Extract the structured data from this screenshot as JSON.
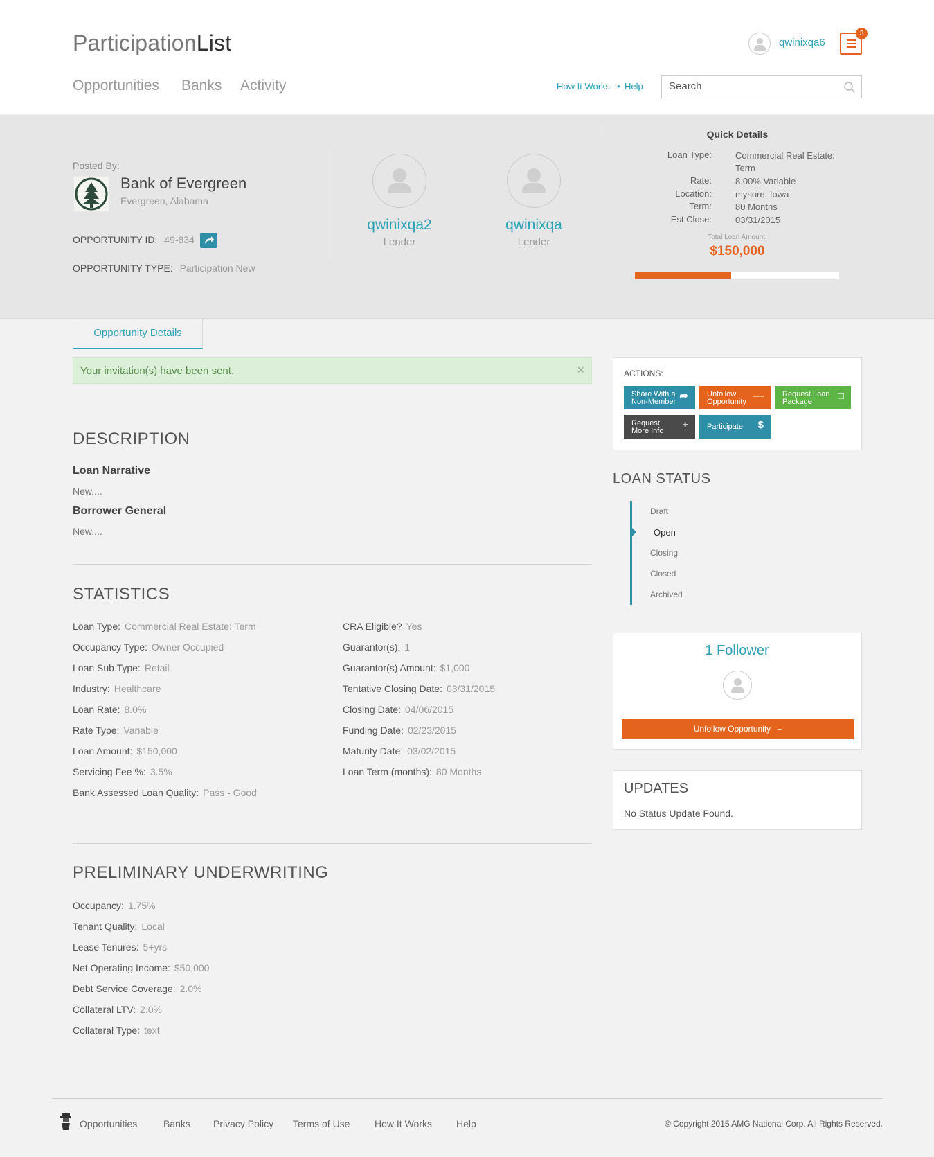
{
  "header": {
    "logo_light": "Participation",
    "logo_bold": "List",
    "nav": [
      "Opportunities",
      "Banks",
      "Activity"
    ],
    "user_name": "qwinixqa6",
    "notification_count": "3",
    "links": [
      "How It Works",
      "•",
      "Help"
    ],
    "search_placeholder": "Search"
  },
  "posting": {
    "posted_by_label": "Posted By:",
    "bank_name": "Bank of Evergreen",
    "bank_location": "Evergreen, Alabama",
    "opportunity_id_label": "OPPORTUNITY ID:",
    "opportunity_id": "49-834",
    "opportunity_type_label": "OPPORTUNITY TYPE:",
    "opportunity_type": "Participation New"
  },
  "lenders": [
    {
      "name": "qwinixqa2",
      "role": "Lender"
    },
    {
      "name": "qwinixqa",
      "role": "Lender"
    }
  ],
  "quick_details": {
    "title": "Quick Details",
    "rows": [
      {
        "key": "Loan Type:",
        "value": "Commercial Real Estate: Term"
      },
      {
        "key": "Rate:",
        "value": "8.00% Variable"
      },
      {
        "key": "Location:",
        "value": "mysore, Iowa"
      },
      {
        "key": "Term:",
        "value": "80 Months"
      },
      {
        "key": "Est Close:",
        "value": "03/31/2015"
      }
    ],
    "total_label": "Total Loan Amount:",
    "total_amount": "$150,000",
    "funded_fraction": 0.47,
    "accent_color": "#e5641d"
  },
  "tab": {
    "label": "Opportunity Details"
  },
  "alert": {
    "message": "Your invitation(s) have been sent.",
    "close": "×"
  },
  "description": {
    "title": "DESCRIPTION",
    "sections": [
      {
        "heading": "Loan Narrative",
        "text": "New...."
      },
      {
        "heading": "Borrower General",
        "text": "New...."
      }
    ]
  },
  "statistics": {
    "title": "STATISTICS",
    "left": [
      {
        "key": "Loan Type:",
        "value": "Commercial Real Estate: Term"
      },
      {
        "key": "Occupancy Type:",
        "value": "Owner Occupied"
      },
      {
        "key": "Loan Sub Type:",
        "value": "Retail"
      },
      {
        "key": "Industry:",
        "value": "Healthcare"
      },
      {
        "key": "Loan Rate:",
        "value": "8.0%"
      },
      {
        "key": "Rate Type:",
        "value": "Variable"
      },
      {
        "key": "Loan Amount:",
        "value": "$150,000"
      },
      {
        "key": "Servicing Fee %:",
        "value": "3.5%"
      },
      {
        "key": "Bank Assessed Loan Quality:",
        "value": "Pass - Good"
      }
    ],
    "right": [
      {
        "key": "CRA Eligible?",
        "value": "Yes"
      },
      {
        "key": "Guarantor(s):",
        "value": "1"
      },
      {
        "key": "Guarantor(s) Amount:",
        "value": "$1,000"
      },
      {
        "key": "Tentative Closing Date:",
        "value": "03/31/2015"
      },
      {
        "key": "Closing Date:",
        "value": "04/06/2015"
      },
      {
        "key": "Funding Date:",
        "value": "02/23/2015"
      },
      {
        "key": "Maturity Date:",
        "value": "03/02/2015"
      },
      {
        "key": "Loan Term (months):",
        "value": "80 Months"
      }
    ]
  },
  "underwriting": {
    "title": "PRELIMINARY UNDERWRITING",
    "rows": [
      {
        "key": "Occupancy:",
        "value": "1.75%"
      },
      {
        "key": "Tenant Quality:",
        "value": "Local"
      },
      {
        "key": "Lease Tenures:",
        "value": "5+yrs"
      },
      {
        "key": "Net Operating Income:",
        "value": "$50,000"
      },
      {
        "key": "Debt Service Coverage:",
        "value": "2.0%"
      },
      {
        "key": "Collateral LTV:",
        "value": "2.0%"
      },
      {
        "key": "Collateral Type:",
        "value": "text"
      }
    ]
  },
  "actions": {
    "title": "ACTIONS:",
    "buttons": [
      {
        "line1": "Share With a",
        "line2": "Non-Member",
        "icon": "share-icon",
        "color": "#2f8ea8"
      },
      {
        "line1": "Unfollow",
        "line2": "Opportunity",
        "icon": "minus-icon",
        "color": "#e5641d"
      },
      {
        "line1": "Request Loan",
        "line2": "Package",
        "icon": "document-icon",
        "color": "#5cb545"
      },
      {
        "line1": "Request",
        "line2": "More Info",
        "icon": "plus-icon",
        "color": "#4a4a4a"
      },
      {
        "line1": "Participate",
        "line2": "",
        "icon": "dollar-icon",
        "color": "#2f8ea8"
      }
    ]
  },
  "loan_status": {
    "title": "LOAN STATUS",
    "items": [
      "Draft",
      "Open",
      "Closing",
      "Closed",
      "Archived"
    ],
    "current": "Open"
  },
  "followers": {
    "title": "1 Follower",
    "button": "Unfollow Opportunity"
  },
  "updates": {
    "title": "UPDATES",
    "text": "No Status Update Found."
  },
  "footer": {
    "nav": [
      "Opportunities",
      "Banks",
      "Privacy Policy",
      "Terms of Use",
      "How It Works",
      "Help"
    ],
    "copyright": "© Copyright 2015 AMG National Corp. All Rights Reserved."
  }
}
